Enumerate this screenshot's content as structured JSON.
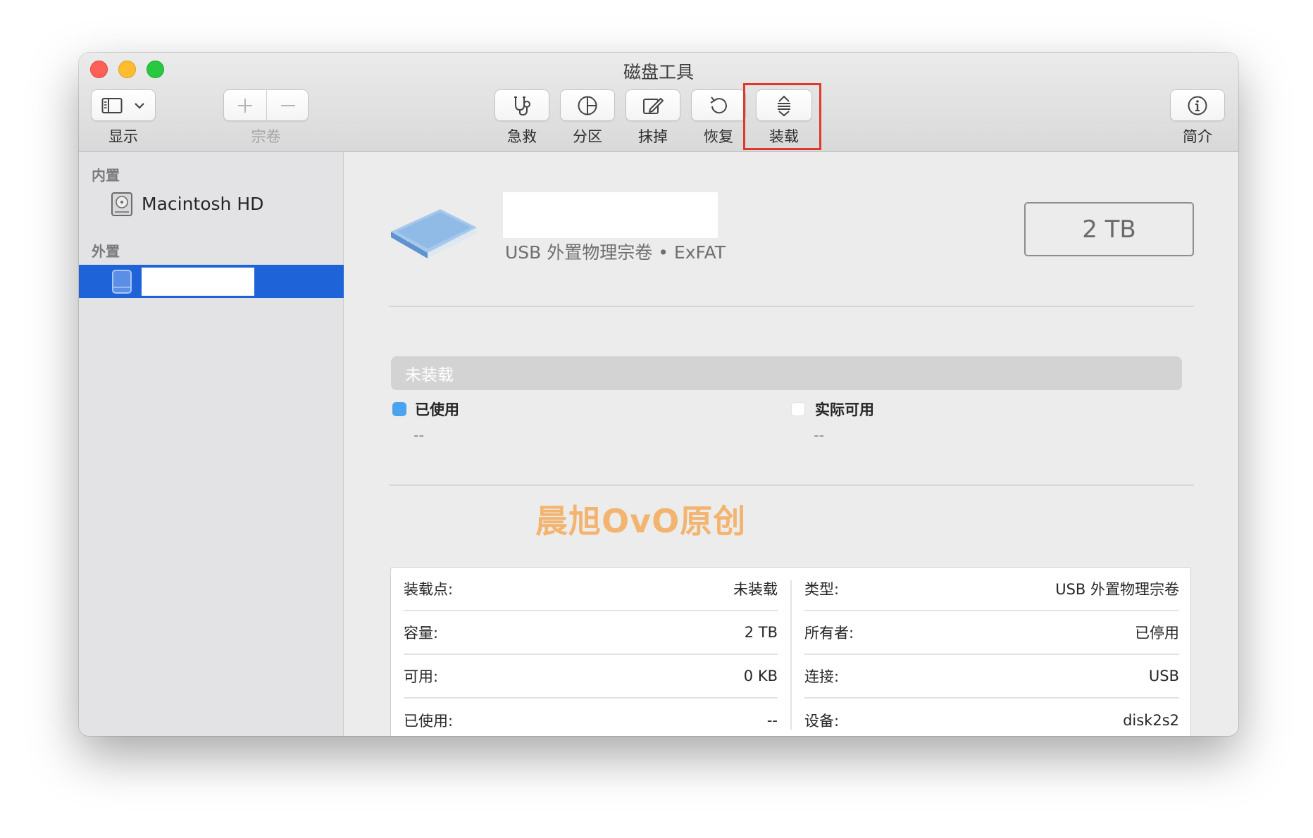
{
  "window": {
    "title": "磁盘工具"
  },
  "toolbar": {
    "view_label": "显示",
    "volume_label": "宗卷",
    "first_aid_label": "急救",
    "partition_label": "分区",
    "erase_label": "抹掉",
    "restore_label": "恢复",
    "mount_label": "装载",
    "info_label": "简介"
  },
  "sidebar": {
    "internal_heading": "内置",
    "internal_items": [
      {
        "label": "Macintosh HD"
      }
    ],
    "external_heading": "外置"
  },
  "volume": {
    "subtitle": "USB 外置物理宗卷 • ExFAT",
    "capacity": "2 TB"
  },
  "usage": {
    "status": "未装载",
    "used_label": "已使用",
    "used_value": "--",
    "available_label": "实际可用",
    "available_value": "--",
    "used_color": "#4aa3f0",
    "available_color": "#ffffff"
  },
  "watermark": "晨旭OvO原创",
  "info": {
    "left": [
      {
        "key": "装载点:",
        "value": "未装载"
      },
      {
        "key": "容量:",
        "value": "2 TB"
      },
      {
        "key": "可用:",
        "value": "0 KB"
      },
      {
        "key": "已使用:",
        "value": "--"
      }
    ],
    "right": [
      {
        "key": "类型:",
        "value": "USB 外置物理宗卷"
      },
      {
        "key": "所有者:",
        "value": "已停用"
      },
      {
        "key": "连接:",
        "value": "USB"
      },
      {
        "key": "设备:",
        "value": "disk2s2"
      }
    ]
  },
  "colors": {
    "accent": "#1f63d8",
    "highlight_border": "#e0392b"
  }
}
